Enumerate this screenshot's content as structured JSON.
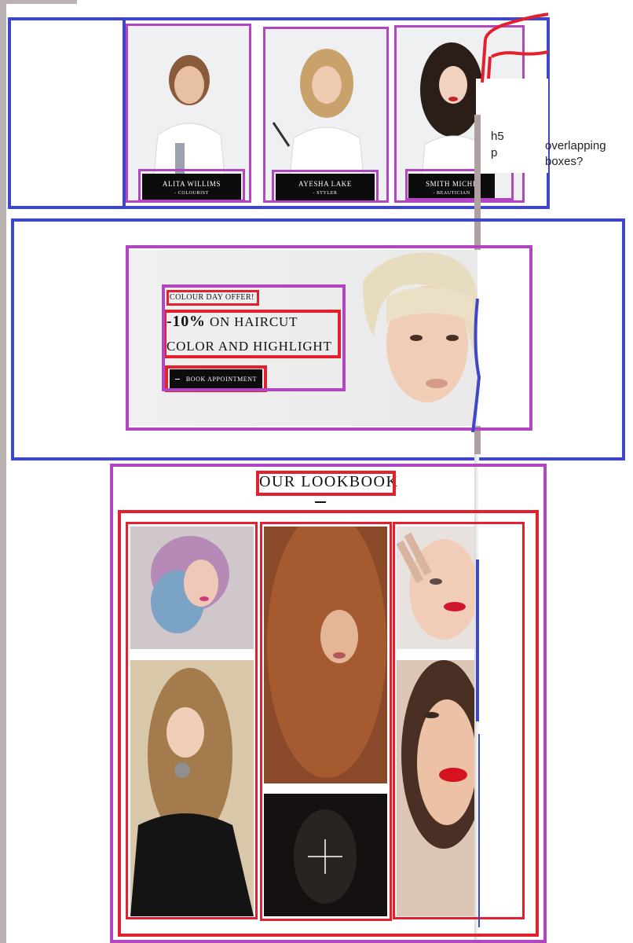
{
  "team": {
    "members": [
      {
        "name": "ALITA WILLIMS",
        "role": "- COLOURIST"
      },
      {
        "name": "AYESHA LAKE",
        "role": "- STYLER"
      },
      {
        "name": "SMITH MICHE",
        "role": "- BEAUTICIAN"
      }
    ]
  },
  "offer": {
    "kicker": "COLOUR DAY OFFER!",
    "discount": "-10%",
    "line1_rest": "ON HAIRCUT",
    "line2": "COLOR AND HIGHLIGHT",
    "button_label": "BOOK APPOINTMENT"
  },
  "lookbook": {
    "title": "OUR LOOKBOOK"
  },
  "annotations": {
    "tag_h5": "h5",
    "tag_p": "p",
    "note_line1": "overlapping",
    "note_line2": "boxes?"
  },
  "colors": {
    "annotation_blue": "#4046c8",
    "annotation_purple": "#b246c0",
    "annotation_red": "#e4202e",
    "plate_black": "#0c0c0c"
  }
}
